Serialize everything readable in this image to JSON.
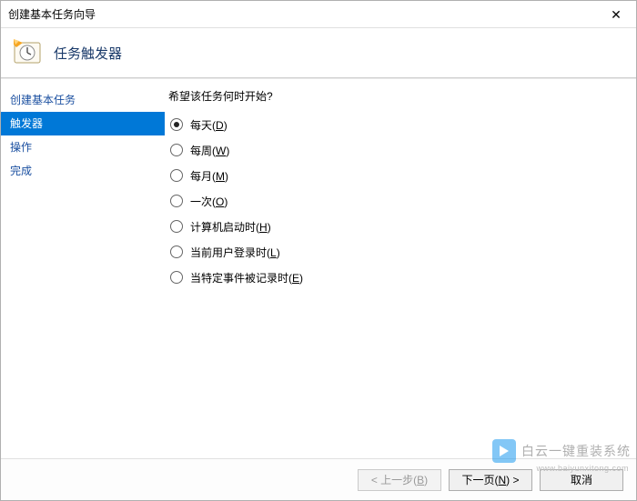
{
  "window": {
    "title": "创建基本任务向导"
  },
  "header": {
    "title": "任务触发器"
  },
  "sidebar": {
    "items": [
      {
        "label": "创建基本任务",
        "selected": false
      },
      {
        "label": "触发器",
        "selected": true
      },
      {
        "label": "操作",
        "selected": false
      },
      {
        "label": "完成",
        "selected": false
      }
    ]
  },
  "main": {
    "question": "希望该任务何时开始?",
    "options": [
      {
        "label": "每天",
        "accel": "D",
        "checked": true
      },
      {
        "label": "每周",
        "accel": "W",
        "checked": false
      },
      {
        "label": "每月",
        "accel": "M",
        "checked": false
      },
      {
        "label": "一次",
        "accel": "O",
        "checked": false
      },
      {
        "label": "计算机启动时",
        "accel": "H",
        "checked": false
      },
      {
        "label": "当前用户登录时",
        "accel": "L",
        "checked": false
      },
      {
        "label": "当特定事件被记录时",
        "accel": "E",
        "checked": false
      }
    ]
  },
  "footer": {
    "back": {
      "text": "< 上一步",
      "accel": "B"
    },
    "next": {
      "text": "下一页",
      "accel": "N",
      "suffix": " >"
    },
    "cancel": {
      "text": "取消"
    }
  },
  "watermark": {
    "brand": "白云一键重装系统",
    "url": "www.baiyunxitong.com"
  }
}
